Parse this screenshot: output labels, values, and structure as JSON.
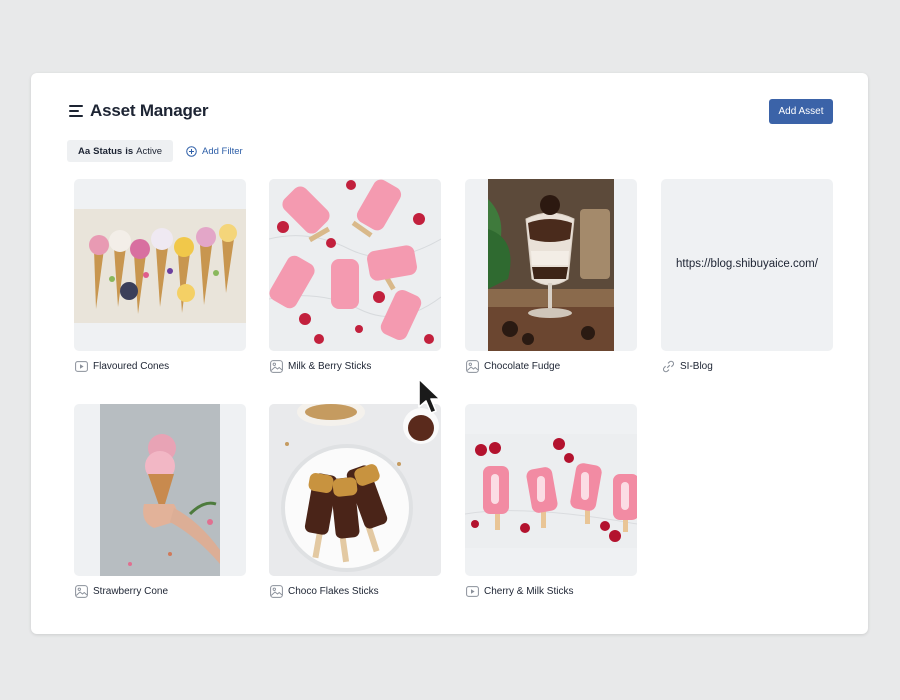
{
  "header": {
    "title": "Asset Manager",
    "add_button": "Add Asset"
  },
  "filters": {
    "chip_prefix": "Aa",
    "chip_field": "Status",
    "chip_op": "is",
    "chip_value": "Active",
    "add_filter_label": "Add Filter"
  },
  "assets": [
    {
      "name": "Flavoured Cones",
      "type_icon": "video-icon"
    },
    {
      "name": "Milk & Berry Sticks",
      "type_icon": "image-icon"
    },
    {
      "name": "Chocolate Fudge",
      "type_icon": "image-icon"
    },
    {
      "name": "SI-Blog",
      "type_icon": "link-icon",
      "url": "https://blog.shibuyaice.com/"
    },
    {
      "name": "Strawberry Cone",
      "type_icon": "image-icon"
    },
    {
      "name": "Choco Flakes Sticks",
      "type_icon": "image-icon"
    },
    {
      "name": "Cherry & Milk Sticks",
      "type_icon": "video-icon"
    }
  ],
  "colors": {
    "accent": "#3b63a8",
    "link": "#2e5fa8",
    "tile_bg": "#eff1f3",
    "text": "#1d2433"
  }
}
